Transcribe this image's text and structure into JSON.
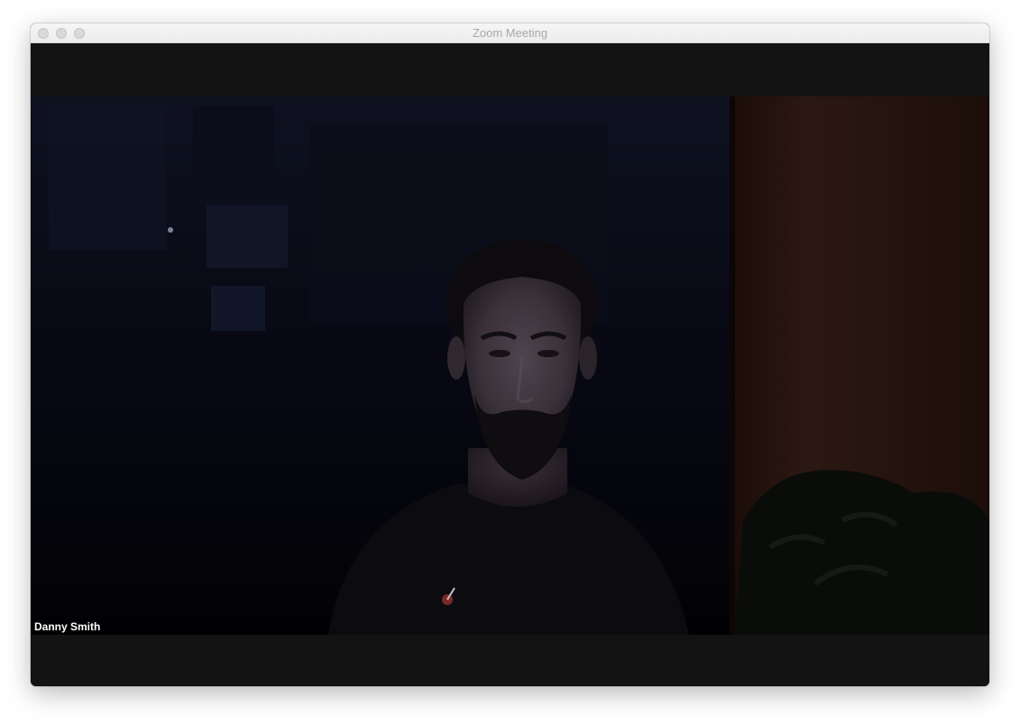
{
  "window": {
    "title": "Zoom Meeting",
    "controls": [
      "close-button",
      "minimize-button",
      "zoom-button"
    ]
  },
  "video": {
    "participant_name": "Danny Smith"
  }
}
